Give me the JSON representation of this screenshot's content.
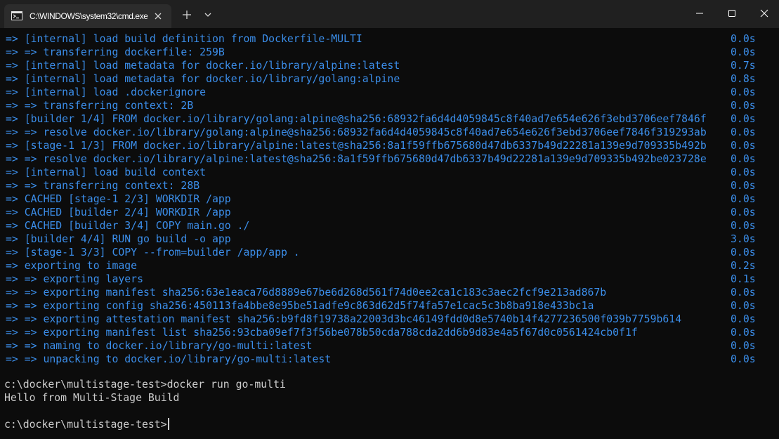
{
  "window": {
    "tab_title": "C:\\WINDOWS\\system32\\cmd.exe",
    "icons": {
      "tab_icon": "terminal-icon",
      "tab_close": "close-icon",
      "new_tab": "plus-icon",
      "dropdown": "chevron-down-icon",
      "minimize": "minimize-icon",
      "maximize": "maximize-icon",
      "close": "close-icon"
    }
  },
  "colors": {
    "background": "#0c0c0c",
    "titlebar": "#202020",
    "active_tab": "#2c2c2c",
    "build_output": "#3b8eea",
    "plain_text": "#cccccc"
  },
  "build_output": [
    {
      "text": "=> [internal] load build definition from Dockerfile-MULTI",
      "time": "0.0s"
    },
    {
      "text": "=> => transferring dockerfile: 259B",
      "time": "0.0s"
    },
    {
      "text": "=> [internal] load metadata for docker.io/library/alpine:latest",
      "time": "0.7s"
    },
    {
      "text": "=> [internal] load metadata for docker.io/library/golang:alpine",
      "time": "0.8s"
    },
    {
      "text": "=> [internal] load .dockerignore",
      "time": "0.0s"
    },
    {
      "text": "=> => transferring context: 2B",
      "time": "0.0s"
    },
    {
      "text": "=> [builder 1/4] FROM docker.io/library/golang:alpine@sha256:68932fa6d4d4059845c8f40ad7e654e626f3ebd3706eef7846f",
      "time": "0.0s"
    },
    {
      "text": "=> => resolve docker.io/library/golang:alpine@sha256:68932fa6d4d4059845c8f40ad7e654e626f3ebd3706eef7846f319293ab",
      "time": "0.0s"
    },
    {
      "text": "=> [stage-1 1/3] FROM docker.io/library/alpine:latest@sha256:8a1f59ffb675680d47db6337b49d22281a139e9d709335b492b",
      "time": "0.0s"
    },
    {
      "text": "=> => resolve docker.io/library/alpine:latest@sha256:8a1f59ffb675680d47db6337b49d22281a139e9d709335b492be023728e",
      "time": "0.0s"
    },
    {
      "text": "=> [internal] load build context",
      "time": "0.0s"
    },
    {
      "text": "=> => transferring context: 28B",
      "time": "0.0s"
    },
    {
      "text": "=> CACHED [stage-1 2/3] WORKDIR /app",
      "time": "0.0s"
    },
    {
      "text": "=> CACHED [builder 2/4] WORKDIR /app",
      "time": "0.0s"
    },
    {
      "text": "=> CACHED [builder 3/4] COPY main.go ./",
      "time": "0.0s"
    },
    {
      "text": "=> [builder 4/4] RUN go build -o app",
      "time": "3.0s"
    },
    {
      "text": "=> [stage-1 3/3] COPY --from=builder /app/app .",
      "time": "0.0s"
    },
    {
      "text": "=> exporting to image",
      "time": "0.2s"
    },
    {
      "text": "=> => exporting layers",
      "time": "0.1s"
    },
    {
      "text": "=> => exporting manifest sha256:63e1eaca76d8889e67be6d268d561f74d0ee2ca1c183c3aec2fcf9e213ad867b",
      "time": "0.0s"
    },
    {
      "text": "=> => exporting config sha256:450113fa4bbe8e95be51adfe9c863d62d5f74fa57e1cac5c3b8ba918e433bc1a",
      "time": "0.0s"
    },
    {
      "text": "=> => exporting attestation manifest sha256:b9fd8f19738a22003d3bc46149fdd0d8e5740b14f4277236500f039b7759b614",
      "time": "0.0s"
    },
    {
      "text": "=> => exporting manifest list sha256:93cba09ef7f3f56be078b50cda788cda2dd6b9d83e4a5f67d0c0561424cb0f1f",
      "time": "0.0s"
    },
    {
      "text": "=> => naming to docker.io/library/go-multi:latest",
      "time": "0.0s"
    },
    {
      "text": "=> => unpacking to docker.io/library/go-multi:latest",
      "time": "0.0s"
    }
  ],
  "console": {
    "command_line": "c:\\docker\\multistage-test>docker run go-multi",
    "program_output": "Hello from Multi-Stage Build",
    "prompt": "c:\\docker\\multistage-test>"
  }
}
